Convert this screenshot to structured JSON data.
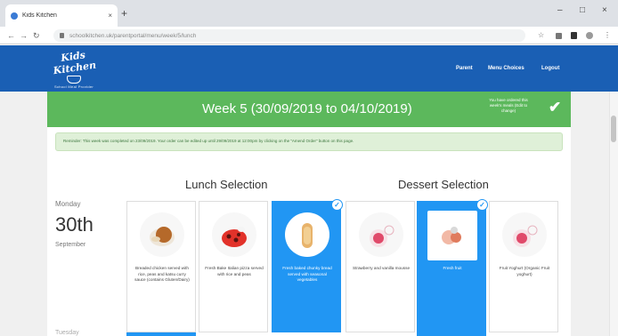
{
  "browser": {
    "tab_title": "Kids Kitchen",
    "tab_close": "×",
    "new_tab": "+",
    "window_min": "–",
    "window_max": "□",
    "window_close": "×",
    "back": "←",
    "forward": "→",
    "reload": "↻",
    "address": "schoolkitchen.uk/parentportal/menu/week/5/lunch",
    "ext1": "☆",
    "ext2": "⋮"
  },
  "header": {
    "logo_text": "Kids Kitchen",
    "logo_tagline": "School Meal Provider",
    "nav": [
      "Parent",
      "Menu Choices",
      "Logout"
    ]
  },
  "week": {
    "title": "Week 5 (30/09/2019 to 04/10/2019)",
    "status_note": "You have ordered this week's meals (Edit to change)",
    "check": "✔"
  },
  "alert": {
    "text": "Reminder: This week was completed on 23/09/2019. Your order can be edited up until 29/09/2019 at 12:00pm by clicking on the \"Amend Order\" button on this page."
  },
  "sections": {
    "lunch": "Lunch Selection",
    "dessert": "Dessert Selection"
  },
  "day": {
    "name": "Monday",
    "number": "30th",
    "month": "September"
  },
  "lunch_options": [
    {
      "caption": "Breaded chicken served with rice, peas and katsu curry sauce (contains Gluten/Dairy)",
      "selected": false,
      "icon": "chicken-katsu-icon"
    },
    {
      "caption": "Fresh Bake Italian pizza served with rice and peas",
      "selected": false,
      "icon": "pizza-icon"
    },
    {
      "caption": "Fresh baked chunky bread served with seasonal vegetables",
      "selected": true,
      "icon": "bread-icon"
    }
  ],
  "dessert_options": [
    {
      "caption": "Strawberry and vanilla mousse",
      "selected": false,
      "icon": "mousse-icon"
    },
    {
      "caption": "Fresh fruit",
      "selected": true,
      "icon": "fruit-icon"
    },
    {
      "caption": "Fruit Yoghurt (Organic Fruit yoghurt)",
      "selected": false,
      "icon": "yoghurt-icon"
    }
  ],
  "next_day_label": "Tuesday",
  "colors": {
    "header_blue": "#1a5fb4",
    "banner_green": "#5cb85c",
    "selected_blue": "#2196f3",
    "alert_bg": "#dff0d8"
  }
}
